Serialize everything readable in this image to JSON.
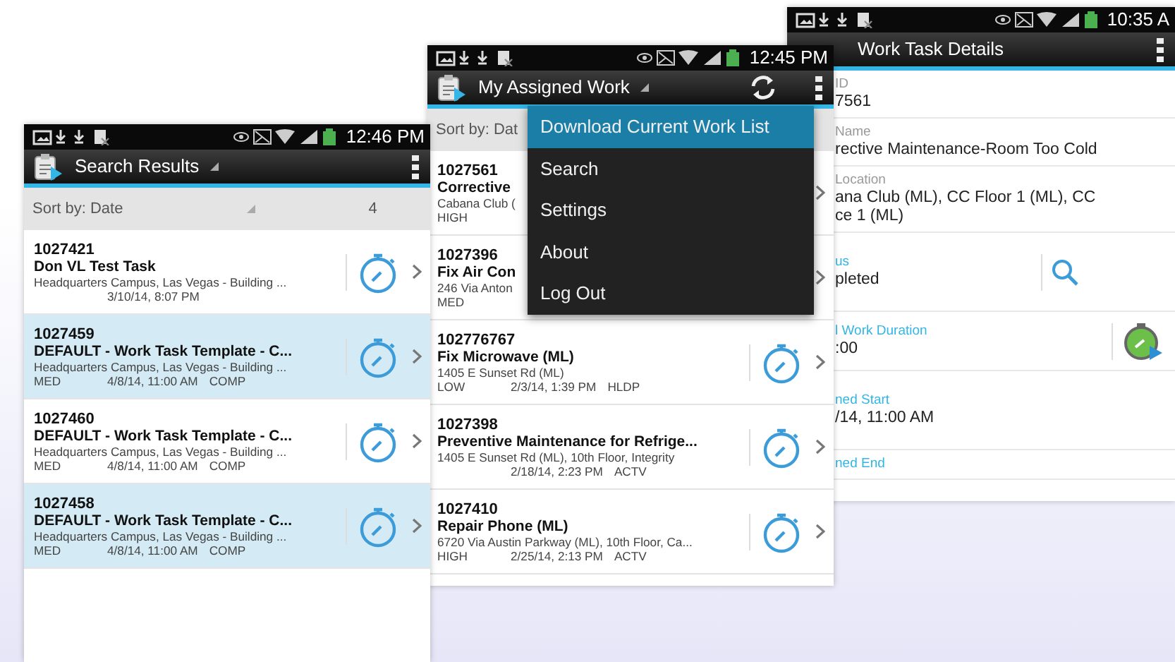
{
  "task_details": {
    "status_bar": {
      "time": "10:35 A"
    },
    "header": {
      "title": "Work Task Details",
      "dropdown": false,
      "refresh": false
    },
    "fields": [
      {
        "label": "ID",
        "value_lines": [
          "7561"
        ],
        "accent": false,
        "kind": "plain"
      },
      {
        "label": "Name",
        "value_lines": [
          "rective Maintenance-Room Too Cold"
        ],
        "accent": false,
        "kind": "plain"
      },
      {
        "label": "Location",
        "value_lines": [
          "ana Club (ML), CC Floor 1 (ML), CC",
          "ce 1 (ML)"
        ],
        "accent": false,
        "kind": "plain"
      },
      {
        "label": "us",
        "value_lines": [
          "pleted"
        ],
        "accent": true,
        "kind": "search"
      },
      {
        "label": "l Work Duration",
        "value_lines": [
          ":00"
        ],
        "accent": true,
        "kind": "timer"
      },
      {
        "label": "ned Start",
        "value_lines": [
          "/14, 11:00 AM"
        ],
        "accent": true,
        "kind": "plain"
      },
      {
        "label": "ned End",
        "accent": true,
        "kind": "plain"
      }
    ]
  },
  "assigned_work": {
    "status_bar": {
      "time": "12:45 PM"
    },
    "header": {
      "title": "My Assigned Work",
      "dropdown": true,
      "refresh": true
    },
    "sort": {
      "label": "Sort by: Dat"
    },
    "rows": [
      {
        "id": "1027561",
        "title": "Corrective",
        "address": "Cabana Club (",
        "priority": "HIGH",
        "selected": false
      },
      {
        "id": "1027396",
        "title": "Fix Air Con",
        "address": "246 Via Anton",
        "priority": "MED",
        "selected": false
      },
      {
        "id": "102776767",
        "title": "Fix Microwave (ML)",
        "address": "1405 E Sunset Rd (ML)",
        "priority": "LOW",
        "date": "2/3/14, 1:39 PM",
        "status": "HLDP",
        "selected": false
      },
      {
        "id": "1027398",
        "title": "Preventive Maintenance for Refrige...",
        "address": "1405 E Sunset Rd (ML), 10th Floor, Integrity",
        "date": "2/18/14, 2:23 PM",
        "status": "ACTV",
        "selected": false
      },
      {
        "id": "1027410",
        "title": "Repair Phone (ML)",
        "address": "6720 Via Austin Parkway (ML), 10th Floor, Ca...",
        "priority": "HIGH",
        "date": "2/25/14, 2:13 PM",
        "status": "ACTV",
        "selected": false
      }
    ],
    "menu": [
      {
        "label": "Download Current Work List",
        "selected": true
      },
      {
        "label": "Search",
        "selected": false
      },
      {
        "label": "Settings",
        "selected": false
      },
      {
        "label": "About",
        "selected": false
      },
      {
        "label": "Log Out",
        "selected": false
      }
    ]
  },
  "search_results": {
    "status_bar": {
      "time": "12:46 PM"
    },
    "header": {
      "title": "Search Results",
      "dropdown": true,
      "refresh": false
    },
    "sort": {
      "label": "Sort by: Date",
      "count": "4"
    },
    "rows": [
      {
        "id": "1027421",
        "title": "Don VL Test Task",
        "address": "Headquarters Campus, Las Vegas - Building ...",
        "date": "3/10/14, 8:07 PM",
        "selected": false
      },
      {
        "id": "1027459",
        "title": "DEFAULT - Work Task Template - C...",
        "address": "Headquarters Campus, Las Vegas - Building ...",
        "priority": "MED",
        "date": "4/8/14, 11:00 AM",
        "status": "COMP",
        "selected": true
      },
      {
        "id": "1027460",
        "title": "DEFAULT - Work Task Template - C...",
        "address": "Headquarters Campus, Las Vegas - Building ...",
        "priority": "MED",
        "date": "4/8/14, 11:00 AM",
        "status": "COMP",
        "selected": false
      },
      {
        "id": "1027458",
        "title": "DEFAULT - Work Task Template - C...",
        "address": "Headquarters Campus, Las Vegas - Building ...",
        "priority": "MED",
        "date": "4/8/14, 11:00 AM",
        "status": "COMP",
        "selected": true
      }
    ]
  }
}
